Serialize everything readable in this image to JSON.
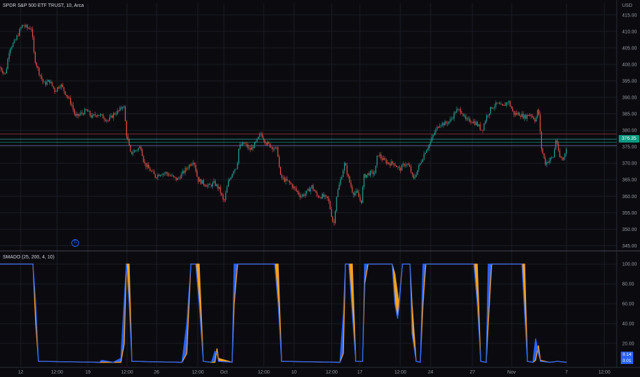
{
  "header": {
    "symbol_title": "SPDR S&P 500 ETF TRUST, 10, Arca",
    "currency": "USD",
    "last_price": "376.35",
    "event_marker": "D"
  },
  "indicator": {
    "title": "SMADO (25, 200, 4, 10)",
    "value_top": "0.14",
    "value_bottom": "0.01"
  },
  "colors": {
    "background": "#0b0b0f",
    "grid": "#1b1d26",
    "up": "#26a69a",
    "down": "#ef5350",
    "indicator_blue": "#2962ff",
    "indicator_orange": "#f7a21b",
    "last_price": "#089981"
  },
  "chart_data": [
    {
      "type": "candlestick",
      "title": "SPDR S&P 500 ETF TRUST, 10, Arca",
      "ylim": [
        343,
        416
      ],
      "y_ticks": [
        345,
        350,
        355,
        360,
        365,
        370,
        375,
        380,
        385,
        390,
        395,
        400,
        405,
        410,
        415
      ],
      "x_ticks": [
        "12",
        "12:00",
        "19",
        "12:00",
        "26",
        "12:00",
        "Oct",
        "12:00",
        "10",
        "12:00",
        "17",
        "12:00",
        "24",
        "12:00",
        "27",
        "12:00",
        "Nov",
        "12:00",
        "7",
        "12:00"
      ],
      "price_path": [
        [
          0,
          399
        ],
        [
          8,
          397
        ],
        [
          14,
          405
        ],
        [
          22,
          407
        ],
        [
          28,
          410
        ],
        [
          33,
          412
        ],
        [
          40,
          411
        ],
        [
          46,
          411
        ],
        [
          50,
          402
        ],
        [
          56,
          398
        ],
        [
          64,
          394
        ],
        [
          72,
          395
        ],
        [
          80,
          392
        ],
        [
          88,
          394
        ],
        [
          96,
          391
        ],
        [
          104,
          388
        ],
        [
          110,
          384
        ],
        [
          118,
          385
        ],
        [
          126,
          386
        ],
        [
          134,
          384
        ],
        [
          142,
          385
        ],
        [
          150,
          384
        ],
        [
          158,
          383
        ],
        [
          166,
          385
        ],
        [
          174,
          386
        ],
        [
          180,
          388
        ],
        [
          184,
          379
        ],
        [
          190,
          373
        ],
        [
          198,
          374
        ],
        [
          205,
          375
        ],
        [
          210,
          370
        ],
        [
          218,
          368
        ],
        [
          226,
          366
        ],
        [
          234,
          367
        ],
        [
          242,
          367
        ],
        [
          250,
          366
        ],
        [
          258,
          365
        ],
        [
          266,
          367
        ],
        [
          274,
          369
        ],
        [
          282,
          371
        ],
        [
          288,
          365
        ],
        [
          296,
          364
        ],
        [
          304,
          363
        ],
        [
          312,
          364
        ],
        [
          320,
          362
        ],
        [
          326,
          358
        ],
        [
          332,
          364
        ],
        [
          340,
          368
        ],
        [
          345,
          369
        ],
        [
          348,
          375
        ],
        [
          356,
          376
        ],
        [
          364,
          374
        ],
        [
          372,
          376
        ],
        [
          380,
          379
        ],
        [
          388,
          376
        ],
        [
          396,
          375
        ],
        [
          404,
          374
        ],
        [
          408,
          366
        ],
        [
          414,
          365
        ],
        [
          422,
          364
        ],
        [
          430,
          362
        ],
        [
          438,
          360
        ],
        [
          446,
          361
        ],
        [
          454,
          363
        ],
        [
          462,
          360
        ],
        [
          470,
          360
        ],
        [
          478,
          359
        ],
        [
          486,
          351
        ],
        [
          490,
          360
        ],
        [
          496,
          365
        ],
        [
          502,
          370
        ],
        [
          508,
          365
        ],
        [
          514,
          361
        ],
        [
          520,
          361
        ],
        [
          526,
          358
        ],
        [
          530,
          366
        ],
        [
          538,
          367
        ],
        [
          546,
          367
        ],
        [
          550,
          373
        ],
        [
          558,
          371
        ],
        [
          566,
          370
        ],
        [
          574,
          370
        ],
        [
          582,
          368
        ],
        [
          590,
          370
        ],
        [
          596,
          369
        ],
        [
          602,
          365
        ],
        [
          608,
          368
        ],
        [
          614,
          371
        ],
        [
          620,
          374
        ],
        [
          626,
          376
        ],
        [
          632,
          379
        ],
        [
          640,
          382
        ],
        [
          648,
          382
        ],
        [
          656,
          383
        ],
        [
          664,
          386
        ],
        [
          672,
          386
        ],
        [
          678,
          383
        ],
        [
          686,
          383
        ],
        [
          694,
          382
        ],
        [
          702,
          380
        ],
        [
          708,
          384
        ],
        [
          716,
          387
        ],
        [
          724,
          388
        ],
        [
          732,
          387
        ],
        [
          740,
          389
        ],
        [
          748,
          385
        ],
        [
          756,
          385
        ],
        [
          764,
          384
        ],
        [
          772,
          385
        ],
        [
          780,
          383
        ],
        [
          784,
          387
        ],
        [
          788,
          375
        ],
        [
          794,
          370
        ],
        [
          800,
          371
        ],
        [
          806,
          372
        ],
        [
          810,
          378
        ],
        [
          814,
          372
        ],
        [
          820,
          371
        ],
        [
          826,
          376
        ]
      ],
      "horizontal_levels": [
        {
          "price": 378.9,
          "color": "#b23645"
        },
        {
          "price": 377.3,
          "color": "#26a69a"
        },
        {
          "price": 376.35,
          "color": "#089981"
        },
        {
          "price": 375.4,
          "color": "#6d7cb0"
        }
      ]
    },
    {
      "type": "area",
      "title": "SMADO (25, 200, 4, 10)",
      "ylim": [
        0,
        105
      ],
      "y_ticks": [
        20,
        40,
        60,
        80,
        100
      ],
      "series": [
        {
          "name": "blue",
          "color": "#2962ff"
        },
        {
          "name": "orange",
          "color": "#f7a21b"
        }
      ],
      "segments": [
        [
          0,
          100,
          100
        ],
        [
          48,
          100,
          100
        ],
        [
          52,
          60,
          40
        ],
        [
          56,
          2,
          2
        ],
        [
          145,
          1,
          1
        ],
        [
          148,
          3,
          1
        ],
        [
          165,
          1,
          1
        ],
        [
          176,
          5,
          1
        ],
        [
          181,
          65,
          20
        ],
        [
          184,
          100,
          100
        ],
        [
          188,
          60,
          100
        ],
        [
          192,
          2,
          2
        ],
        [
          265,
          1,
          1
        ],
        [
          272,
          40,
          10
        ],
        [
          278,
          100,
          100
        ],
        [
          285,
          100,
          100
        ],
        [
          290,
          60,
          100
        ],
        [
          296,
          2,
          2
        ],
        [
          308,
          1,
          1
        ],
        [
          313,
          12,
          1
        ],
        [
          316,
          10,
          15
        ],
        [
          318,
          2,
          5
        ],
        [
          338,
          1,
          1
        ],
        [
          341,
          100,
          60
        ],
        [
          346,
          100,
          100
        ],
        [
          400,
          100,
          100
        ],
        [
          405,
          60,
          100
        ],
        [
          410,
          2,
          2
        ],
        [
          495,
          1,
          1
        ],
        [
          500,
          50,
          10
        ],
        [
          503,
          100,
          100
        ],
        [
          508,
          100,
          100
        ],
        [
          513,
          50,
          100
        ],
        [
          518,
          2,
          2
        ],
        [
          528,
          2,
          2
        ],
        [
          531,
          100,
          80
        ],
        [
          536,
          100,
          100
        ],
        [
          571,
          100,
          100
        ],
        [
          575,
          60,
          90
        ],
        [
          579,
          45,
          70
        ],
        [
          581,
          55,
          60
        ],
        [
          586,
          100,
          100
        ],
        [
          597,
          100,
          100
        ],
        [
          600,
          30,
          60
        ],
        [
          606,
          2,
          2
        ],
        [
          612,
          1,
          1
        ],
        [
          616,
          100,
          60
        ],
        [
          620,
          100,
          100
        ],
        [
          690,
          100,
          100
        ],
        [
          695,
          60,
          100
        ],
        [
          700,
          2,
          2
        ],
        [
          708,
          1,
          1
        ],
        [
          711,
          100,
          40
        ],
        [
          716,
          100,
          100
        ],
        [
          760,
          100,
          100
        ],
        [
          764,
          50,
          100
        ],
        [
          768,
          2,
          2
        ],
        [
          776,
          1,
          1
        ],
        [
          780,
          25,
          3
        ],
        [
          784,
          10,
          18
        ],
        [
          787,
          2,
          3
        ],
        [
          800,
          1,
          1
        ],
        [
          812,
          2,
          2
        ],
        [
          825,
          1,
          1
        ]
      ]
    }
  ]
}
